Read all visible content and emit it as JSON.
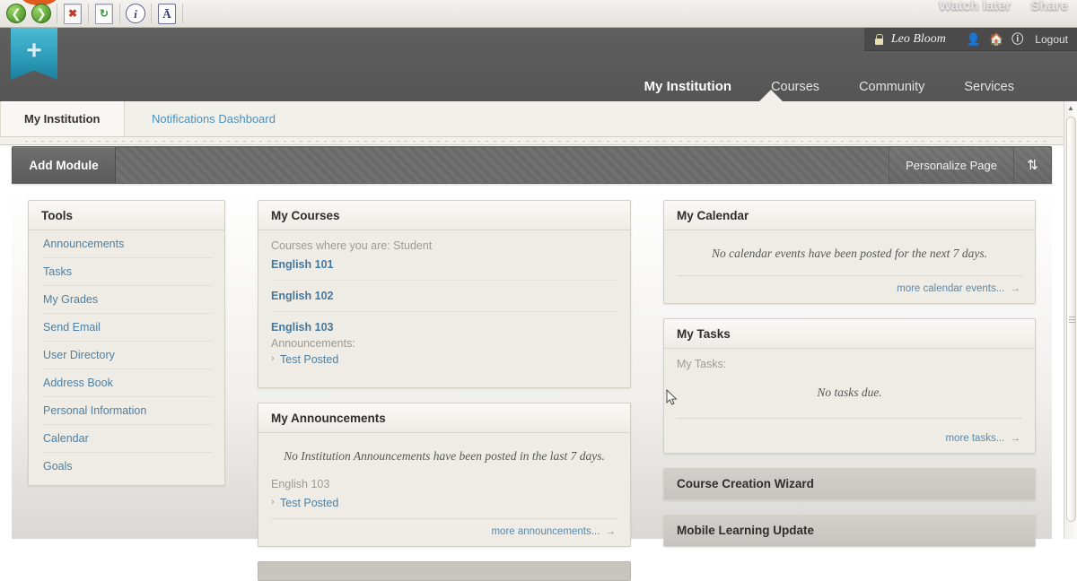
{
  "browser": {
    "toolbar_buttons": [
      {
        "name": "back-button",
        "glyph": "←"
      },
      {
        "name": "forward-button",
        "glyph": "→"
      },
      {
        "name": "stop-button",
        "glyph": "✖"
      },
      {
        "name": "reload-button",
        "glyph": "↻"
      },
      {
        "name": "info-button",
        "glyph": "i"
      },
      {
        "name": "text-encoding-button",
        "glyph": "Ā"
      }
    ]
  },
  "video_overlay": {
    "watch_later": "Watch later",
    "share": "Share"
  },
  "header": {
    "logo_plus": "+",
    "user": {
      "name": "Leo Bloom",
      "logout_label": "Logout",
      "icons": [
        "lock-icon",
        "person-icon",
        "home-icon",
        "help-icon"
      ]
    },
    "nav": [
      {
        "label": "My Institution",
        "active": true
      },
      {
        "label": "Courses",
        "active": false
      },
      {
        "label": "Community",
        "active": false
      },
      {
        "label": "Services",
        "active": false
      }
    ]
  },
  "tabs": [
    {
      "label": "My Institution",
      "active": true
    },
    {
      "label": "Notifications Dashboard",
      "active": false
    }
  ],
  "actionbar": {
    "add_module": "Add Module",
    "personalize": "Personalize Page",
    "sort_icon": "⇅"
  },
  "modules": {
    "tools": {
      "title": "Tools",
      "items": [
        "Announcements",
        "Tasks",
        "My Grades",
        "Send Email",
        "User Directory",
        "Address Book",
        "Personal Information",
        "Calendar",
        "Goals"
      ]
    },
    "my_courses": {
      "title": "My Courses",
      "role_label": "Courses where you are: Student",
      "courses": [
        {
          "name": "English 101",
          "announcements_label": null,
          "announcements": []
        },
        {
          "name": "English 102",
          "announcements_label": null,
          "announcements": []
        },
        {
          "name": "English 103",
          "announcements_label": "Announcements:",
          "announcements": [
            "Test Posted"
          ]
        }
      ]
    },
    "my_announcements": {
      "title": "My Announcements",
      "empty_message": "No Institution Announcements have been posted in the last 7 days.",
      "course_label": "English 103",
      "items": [
        "Test Posted"
      ],
      "more_label": "more announcements...",
      "more_arrow": "→"
    },
    "my_calendar": {
      "title": "My Calendar",
      "empty_message": "No calendar events have been posted for the next 7 days.",
      "more_label": "more calendar events...",
      "more_arrow": "→"
    },
    "my_tasks": {
      "title": "My Tasks",
      "sub_label": "My Tasks:",
      "empty_message": "No tasks due.",
      "more_label": "more tasks...",
      "more_arrow": "→"
    },
    "course_creation_wizard": {
      "title": "Course Creation Wizard"
    },
    "mobile_learning_update": {
      "title": "Mobile Learning Update"
    }
  },
  "colors": {
    "header_bg": "#5a5a5a",
    "logo_teal": "#2e9ebb",
    "link_blue": "#4e7fa3",
    "module_bg": "#eeece4",
    "actionbar_bg": "#6c6c6c"
  }
}
